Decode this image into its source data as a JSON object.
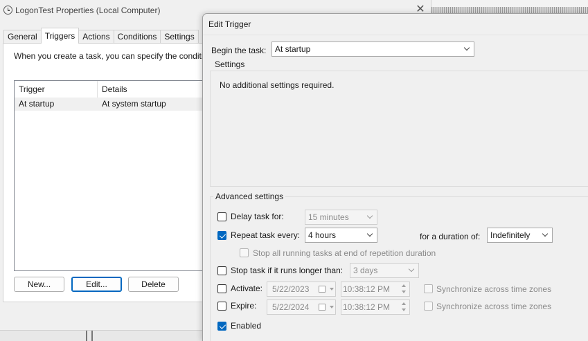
{
  "background_window": {
    "title": "LogonTest Properties (Local Computer)",
    "tabs": [
      {
        "label": "General",
        "active": false
      },
      {
        "label": "Triggers",
        "active": true
      },
      {
        "label": "Actions",
        "active": false
      },
      {
        "label": "Conditions",
        "active": false
      },
      {
        "label": "Settings",
        "active": false
      }
    ],
    "description": "When you create a task, you can specify the conditi",
    "list": {
      "columns": [
        "Trigger",
        "Details"
      ],
      "rows": [
        {
          "trigger": "At startup",
          "details": "At system startup"
        }
      ]
    },
    "buttons": {
      "new": "New...",
      "edit": "Edit...",
      "delete": "Delete"
    }
  },
  "dialog": {
    "title": "Edit Trigger",
    "begin_task": {
      "label": "Begin the task:",
      "value": "At startup"
    },
    "settings": {
      "group_label": "Settings",
      "message": "No additional settings required."
    },
    "advanced": {
      "group_label": "Advanced settings",
      "delay": {
        "label": "Delay task for:",
        "checked": false,
        "value": "15 minutes"
      },
      "repeat": {
        "label": "Repeat task every:",
        "checked": true,
        "value": "4 hours",
        "duration_label": "for a duration of:",
        "duration_value": "Indefinitely"
      },
      "stop_running": {
        "label": "Stop all running tasks at end of repetition duration",
        "checked": false
      },
      "stop_longer": {
        "label": "Stop task if it runs longer than:",
        "checked": false,
        "value": "3 days"
      },
      "activate": {
        "label": "Activate:",
        "checked": false,
        "date": "5/22/2023",
        "time": "10:38:12 PM",
        "sync_label": "Synchronize across time zones"
      },
      "expire": {
        "label": "Expire:",
        "checked": false,
        "date": "5/22/2024",
        "time": "10:38:12 PM",
        "sync_label": "Synchronize across time zones"
      },
      "enabled": {
        "label": "Enabled",
        "checked": true
      }
    }
  }
}
